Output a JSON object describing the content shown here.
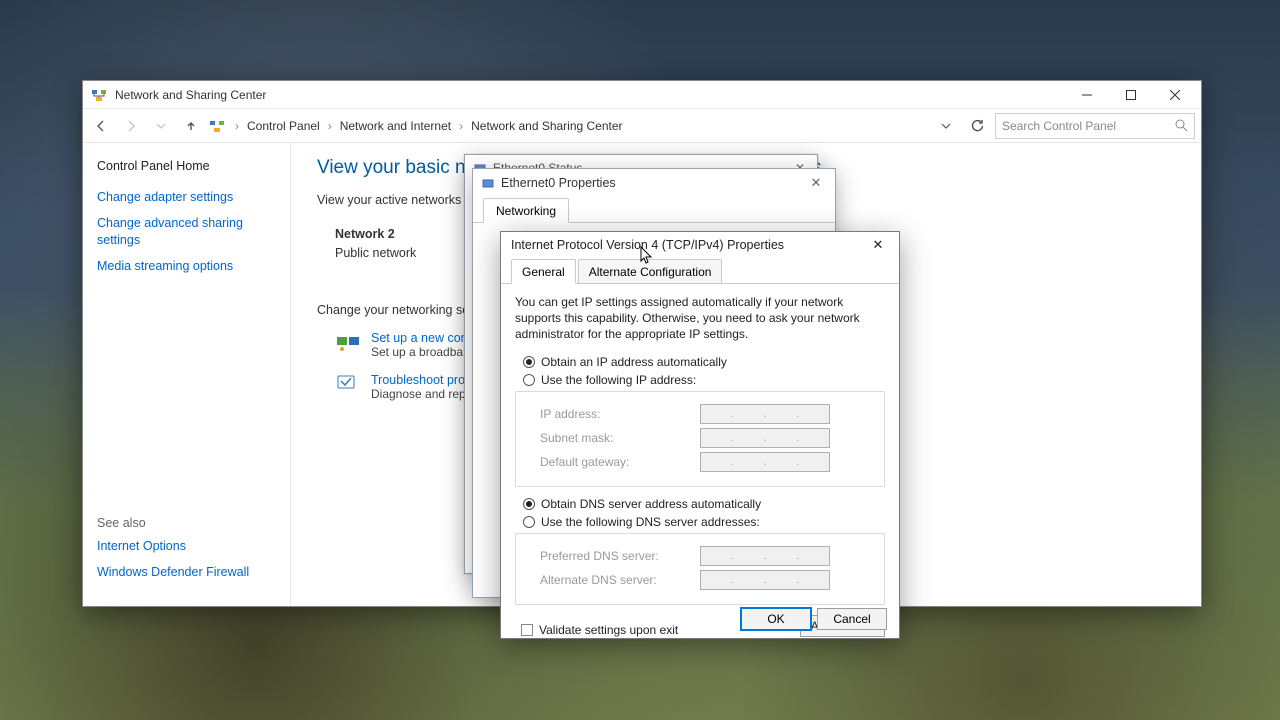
{
  "window": {
    "title": "Network and Sharing Center",
    "breadcrumb": [
      "Control Panel",
      "Network and Internet",
      "Network and Sharing Center"
    ],
    "search_placeholder": "Search Control Panel"
  },
  "sidebar": {
    "home": "Control Panel Home",
    "links": [
      "Change adapter settings",
      "Change advanced sharing settings",
      "Media streaming options"
    ],
    "see_also_header": "See also",
    "see_also": [
      "Internet Options",
      "Windows Defender Firewall"
    ]
  },
  "main": {
    "heading": "View your basic network information and set up connections",
    "subheading": "View your active networks",
    "network": {
      "name": "Network 2",
      "type": "Public network"
    },
    "change_heading": "Change your networking set",
    "tasks": [
      {
        "link": "Set up a new conn",
        "desc": "Set up a broadbar"
      },
      {
        "link": "Troubleshoot prob",
        "desc": "Diagnose and repa"
      }
    ]
  },
  "status_dialog": {
    "title": "Ethernet0 Status"
  },
  "props_dialog": {
    "title": "Ethernet0 Properties",
    "tab": "Networking"
  },
  "ipv4_dialog": {
    "title": "Internet Protocol Version 4 (TCP/IPv4) Properties",
    "tabs": {
      "general": "General",
      "alt": "Alternate Configuration"
    },
    "desc": "You can get IP settings assigned automatically if your network supports this capability. Otherwise, you need to ask your network administrator for the appropriate IP settings.",
    "ip_auto": "Obtain an IP address automatically",
    "ip_static": "Use the following IP address:",
    "fields_ip": {
      "addr": "IP address:",
      "mask": "Subnet mask:",
      "gw": "Default gateway:"
    },
    "dns_auto": "Obtain DNS server address automatically",
    "dns_static": "Use the following DNS server addresses:",
    "fields_dns": {
      "pref": "Preferred DNS server:",
      "alt": "Alternate DNS server:"
    },
    "validate": "Validate settings upon exit",
    "advanced": "Advanced...",
    "ok": "OK",
    "cancel": "Cancel"
  }
}
